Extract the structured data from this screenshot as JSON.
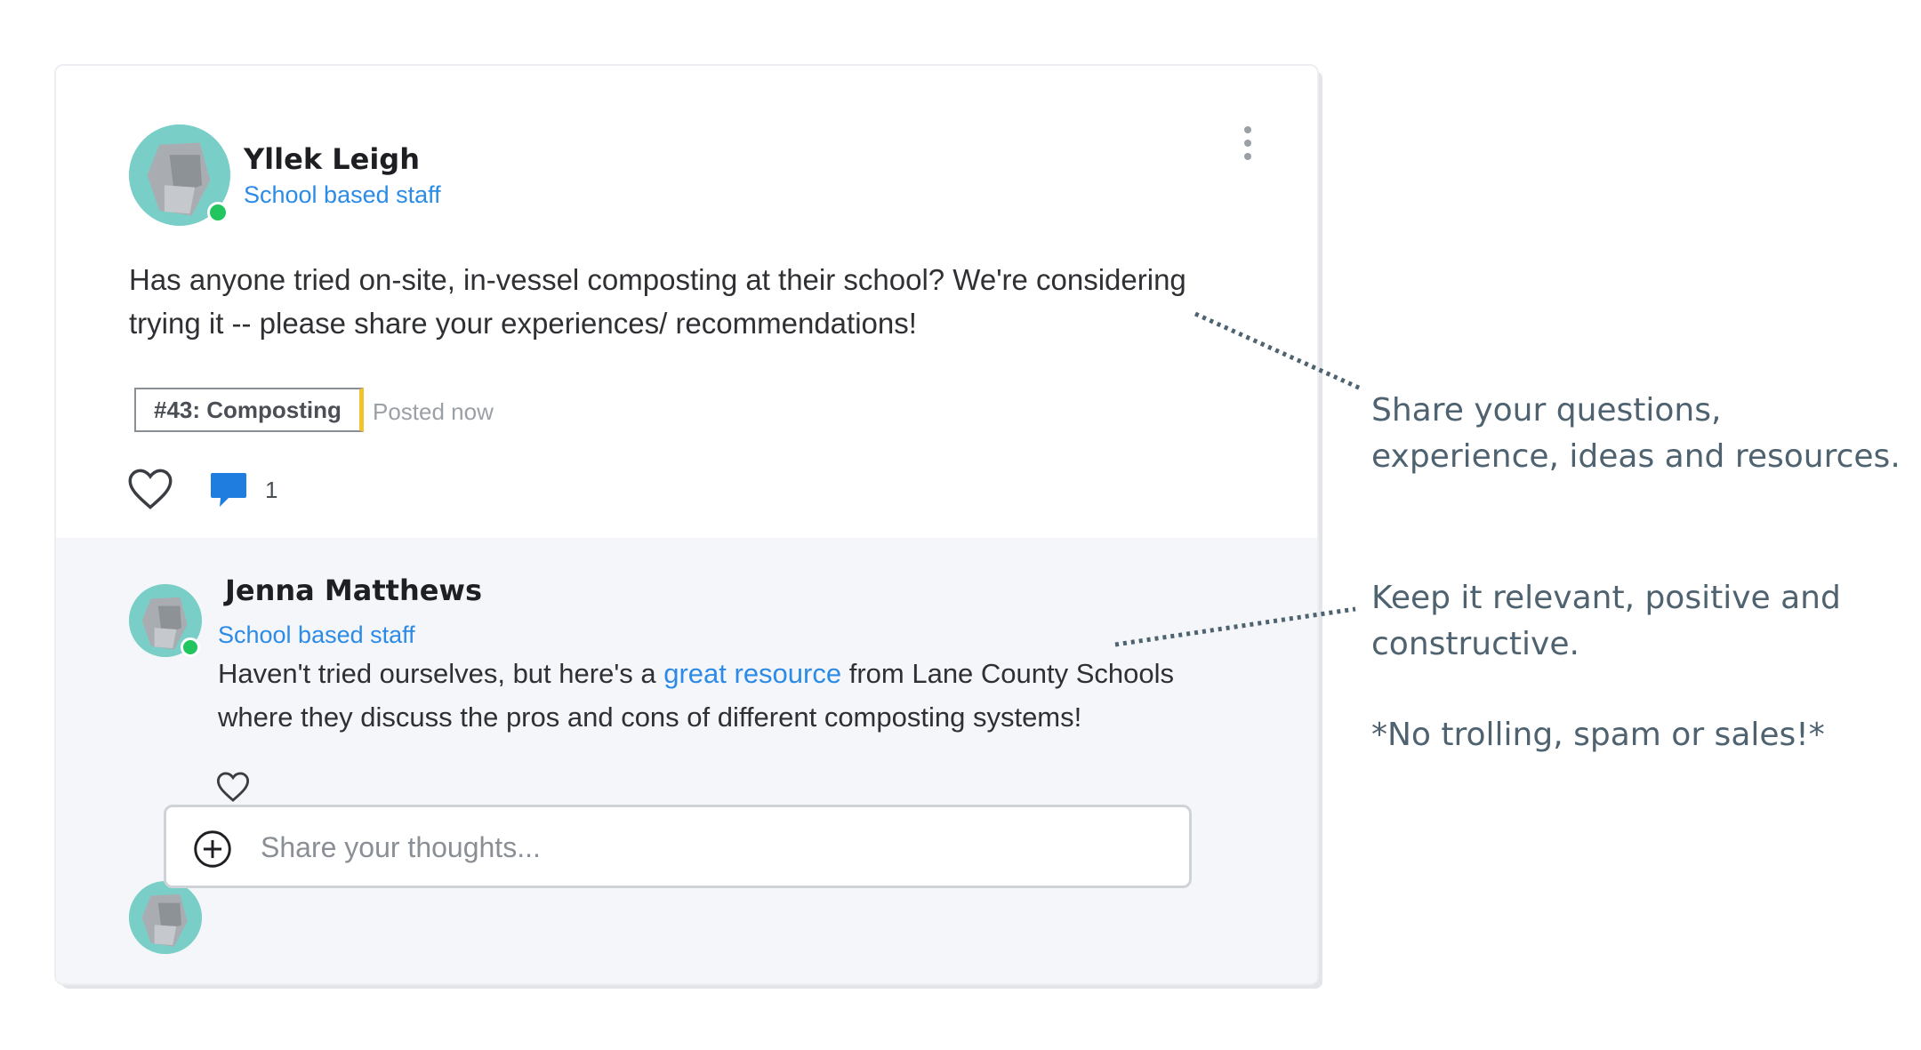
{
  "post": {
    "author": "Yllek Leigh",
    "role": "School based staff",
    "text": "Has anyone tried on-site, in-vessel composting at their school? We're considering trying it -- please share your experiences/ recommendations!",
    "tag": "#43: Composting",
    "posted": "Posted now",
    "comment_count": "1",
    "icons": {
      "menu": "more-vertical-icon",
      "like": "heart-icon",
      "comment": "comment-icon"
    }
  },
  "reply": {
    "author": "Jenna Matthews",
    "role": "School based staff",
    "text_before": "Haven't tried ourselves, but here's a ",
    "link": "great resource",
    "text_after": " from Lane County Schools where they discuss the pros and cons of different composting systems!"
  },
  "composer": {
    "placeholder": "Share your thoughts..."
  },
  "annotations": {
    "one": "Share your questions, experience, ideas and resources.",
    "two": "Keep it relevant, positive and constructive.",
    "three": "*No trolling, spam or sales!*"
  },
  "colors": {
    "accent": "#2b8be6",
    "online": "#22c55e",
    "tag_edge": "#f2c22f",
    "annotation": "#4e6270"
  }
}
